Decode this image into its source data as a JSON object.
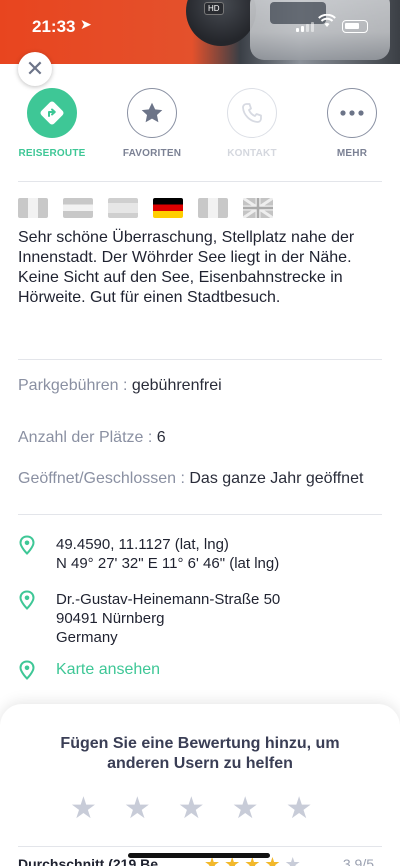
{
  "status_bar": {
    "time": "21:33"
  },
  "header": {
    "hd_badge": "HD"
  },
  "close": {
    "symbol": "✕"
  },
  "actions": [
    {
      "label": "REISEROUTE",
      "icon": "directions-icon",
      "state": "active"
    },
    {
      "label": "FAVORITEN",
      "icon": "star-icon",
      "state": "normal"
    },
    {
      "label": "KONTAKT",
      "icon": "phone-icon",
      "state": "disabled"
    },
    {
      "label": "MEHR",
      "icon": "more-dots-icon",
      "state": "normal"
    }
  ],
  "languages": [
    "italian-flag-icon",
    "austrian-flag-icon",
    "spanish-flag-icon",
    "german-flag-icon",
    "french-flag-icon",
    "uk-flag-icon"
  ],
  "description": "Sehr schöne Überraschung, Stellplatz nahe der Innenstadt. Der Wöhrder See liegt in der Nähe. Keine Sicht auf den See, Eisenbahnstrecke in Hörweite. Gut für einen Stadtbesuch.",
  "details": {
    "parking": {
      "key": "Parkgebühren : ",
      "value": "gebührenfrei"
    },
    "places": {
      "key": "Anzahl der Plätze : ",
      "value": "6"
    },
    "opening": {
      "key": "Geöffnet/Geschlossen : ",
      "value": "Das ganze Jahr geöffnet"
    }
  },
  "location": {
    "coords_line1": "49.4590, 11.1127 (lat, lng)",
    "coords_line2": "N 49° 27' 32\" E 11° 6' 46\" (lat lng)",
    "address_line1": "Dr.-Gustav-Heinemann-Straße 50",
    "address_line2": "90491 Nürnberg",
    "address_line3": "Germany",
    "map_link": "Karte ansehen"
  },
  "rating": {
    "prompt": "Fügen Sie eine Bewertung hinzu, um anderen Usern zu helfen",
    "average_label": "Durchschnitt (219 Be",
    "average_score": "3.9/5",
    "average_value": 3.9
  },
  "colors": {
    "accent": "#3ec796",
    "header_orange": "#e8451f",
    "star_gold": "#f2b82b"
  }
}
